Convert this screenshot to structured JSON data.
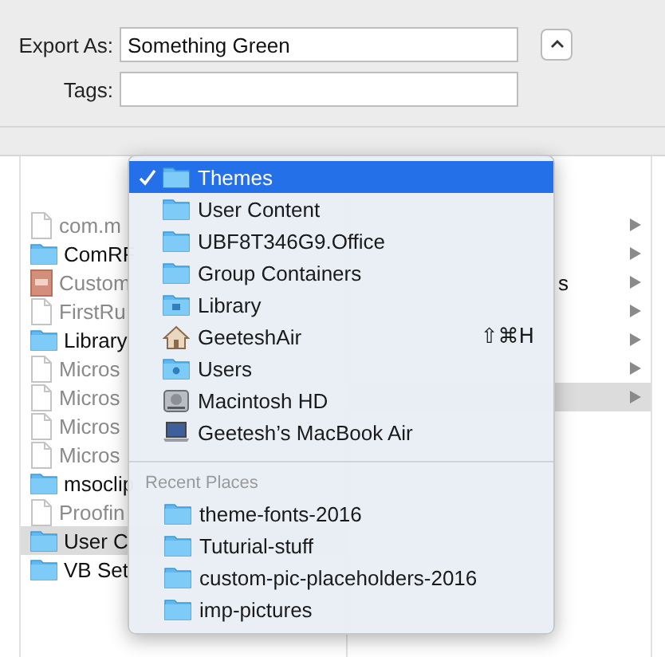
{
  "form": {
    "export_as": {
      "label": "Export As:",
      "value": "Something Green"
    },
    "tags": {
      "label": "Tags:"
    },
    "expand_button": {
      "expanded": false
    }
  },
  "browser": {
    "column_1": [
      {
        "name": "com.m",
        "kind": "doc",
        "selected": false
      },
      {
        "name": "ComRF",
        "kind": "folder",
        "selected": false
      },
      {
        "name": "Custom",
        "kind": "font",
        "selected": false
      },
      {
        "name": "FirstRu",
        "kind": "doc",
        "selected": false
      },
      {
        "name": "Library",
        "kind": "folder",
        "selected": false
      },
      {
        "name": "Micros",
        "kind": "doc",
        "selected": false
      },
      {
        "name": "Micros",
        "kind": "doc",
        "selected": false
      },
      {
        "name": "Micros",
        "kind": "doc",
        "selected": false
      },
      {
        "name": "Micros",
        "kind": "doc",
        "selected": false
      },
      {
        "name": "msoclip",
        "kind": "folder",
        "selected": false
      },
      {
        "name": "Proofin",
        "kind": "doc",
        "selected": false
      },
      {
        "name": "User C",
        "kind": "folder",
        "selected": true
      },
      {
        "name": "VB Set",
        "kind": "folder",
        "selected": false
      }
    ],
    "column_2": [
      {
        "selected": false
      },
      {
        "selected": false
      },
      {
        "name": "s",
        "selected": false
      },
      {
        "selected": false
      },
      {
        "selected": false
      },
      {
        "selected": false
      },
      {
        "selected": true
      }
    ]
  },
  "menu": {
    "items": [
      {
        "label": "Themes",
        "kind": "folder",
        "selected": true
      },
      {
        "label": "User Content",
        "kind": "folder",
        "selected": false
      },
      {
        "label": "UBF8T346G9.Office",
        "kind": "folder",
        "selected": false
      },
      {
        "label": "Group Containers",
        "kind": "folder",
        "selected": false
      },
      {
        "label": "Library",
        "kind": "library",
        "selected": false
      },
      {
        "label": "GeeteshAir",
        "kind": "home",
        "selected": false,
        "shortcut": "⇧⌘H"
      },
      {
        "label": "Users",
        "kind": "users",
        "selected": false
      },
      {
        "label": "Macintosh HD",
        "kind": "disk",
        "selected": false
      },
      {
        "label": "Geetesh’s MacBook Air",
        "kind": "laptop",
        "selected": false
      }
    ],
    "recent_heading": "Recent Places",
    "recent": [
      {
        "label": "theme-fonts-2016"
      },
      {
        "label": "Tuturial-stuff"
      },
      {
        "label": "custom-pic-placeholders-2016"
      },
      {
        "label": "imp-pictures"
      }
    ]
  }
}
